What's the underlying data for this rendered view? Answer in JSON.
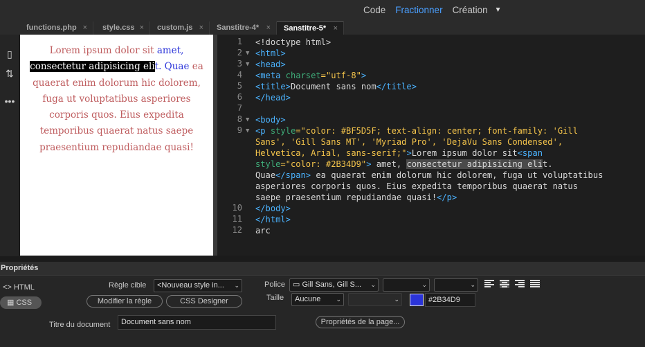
{
  "view_switch": {
    "code": "Code",
    "split": "Fractionner",
    "design": "Création"
  },
  "tabs": [
    {
      "label": "functions.php"
    },
    {
      "label": "style.css"
    },
    {
      "label": "custom.js"
    },
    {
      "label": "Sanstitre-4*"
    },
    {
      "label": "Sanstitre-5*"
    }
  ],
  "preview": {
    "part1": "Lorem ipsum dolor sit ",
    "blue1": "amet, ",
    "selected": "consectetur adipisicing eli",
    "blue2": "t. Quae",
    "part2": " ea quaerat enim dolorum hic dolorem, fuga ut voluptatibus asperiores corporis quos. Eius expedita temporibus quaerat natus saepe praesentium repudiandae quasi!"
  },
  "code": {
    "line_numbers": [
      "1",
      "2",
      "3",
      "4",
      "5",
      "6",
      "7",
      "8",
      "9",
      "10",
      "11",
      "12"
    ],
    "l1": "<!doctype html>",
    "l2": "<html>",
    "l3": "<head>",
    "l4a": "<meta",
    "l4b": " charset",
    "l4c": "=\"utf-8\"",
    "l4d": ">",
    "l5a": "<title>",
    "l5b": "Document sans nom",
    "l5c": "</title>",
    "l6": "</head>",
    "l7": "<body>",
    "l9a": "<p",
    "l9b": " style",
    "l9c": "=\"color: #BF5D5F; text-align: center; font-family: 'Gill",
    "l9d": "Sans', 'Gill Sans MT', 'Myriad Pro', 'DejaVu Sans Condensed',",
    "l9e": "Helvetica, Arial, sans-serif;\"",
    "l9f": ">",
    "l9g": "Lorem ipsum dolor sit",
    "l9h": "<span",
    "l9i": "style",
    "l9j": "=\"color: #2B34D9\"",
    "l9k": ">",
    "l9l": " amet, ",
    "l9m": "consectetur adipisicing eli",
    "l9n": "t.",
    "l9o": "Quae",
    "l9p": "</span>",
    "l9q": " ea quaerat enim dolorum hic dolorem, fuga ut voluptatibus",
    "l9r": "asperiores corporis quos. Eius expedita temporibus quaerat natus",
    "l9s": "saepe praesentium repudiandae quasi!",
    "l9t": "</p>",
    "l10": "</body>",
    "l11": "</html>",
    "l12": "arc"
  },
  "properties": {
    "title": "Propriétés",
    "html_label": "HTML",
    "css_label": "CSS",
    "target_rule_label": "Règle cible",
    "target_rule_value": "<Nouveau style in...",
    "edit_rule_button": "Modifier la règle",
    "css_designer_button": "CSS Designer",
    "font_label": "Police",
    "font_value": "Gill Sans, Gill S...",
    "size_label": "Taille",
    "size_value": "Aucune",
    "color_value": "#2B34D9",
    "doc_title_label": "Titre du document",
    "doc_title_value": "Document sans nom",
    "page_props_button": "Propriétés de la page..."
  },
  "colors": {
    "accent": "#4a9fff",
    "text_color": "#BF5D5F",
    "span_color": "#2B34D9"
  }
}
